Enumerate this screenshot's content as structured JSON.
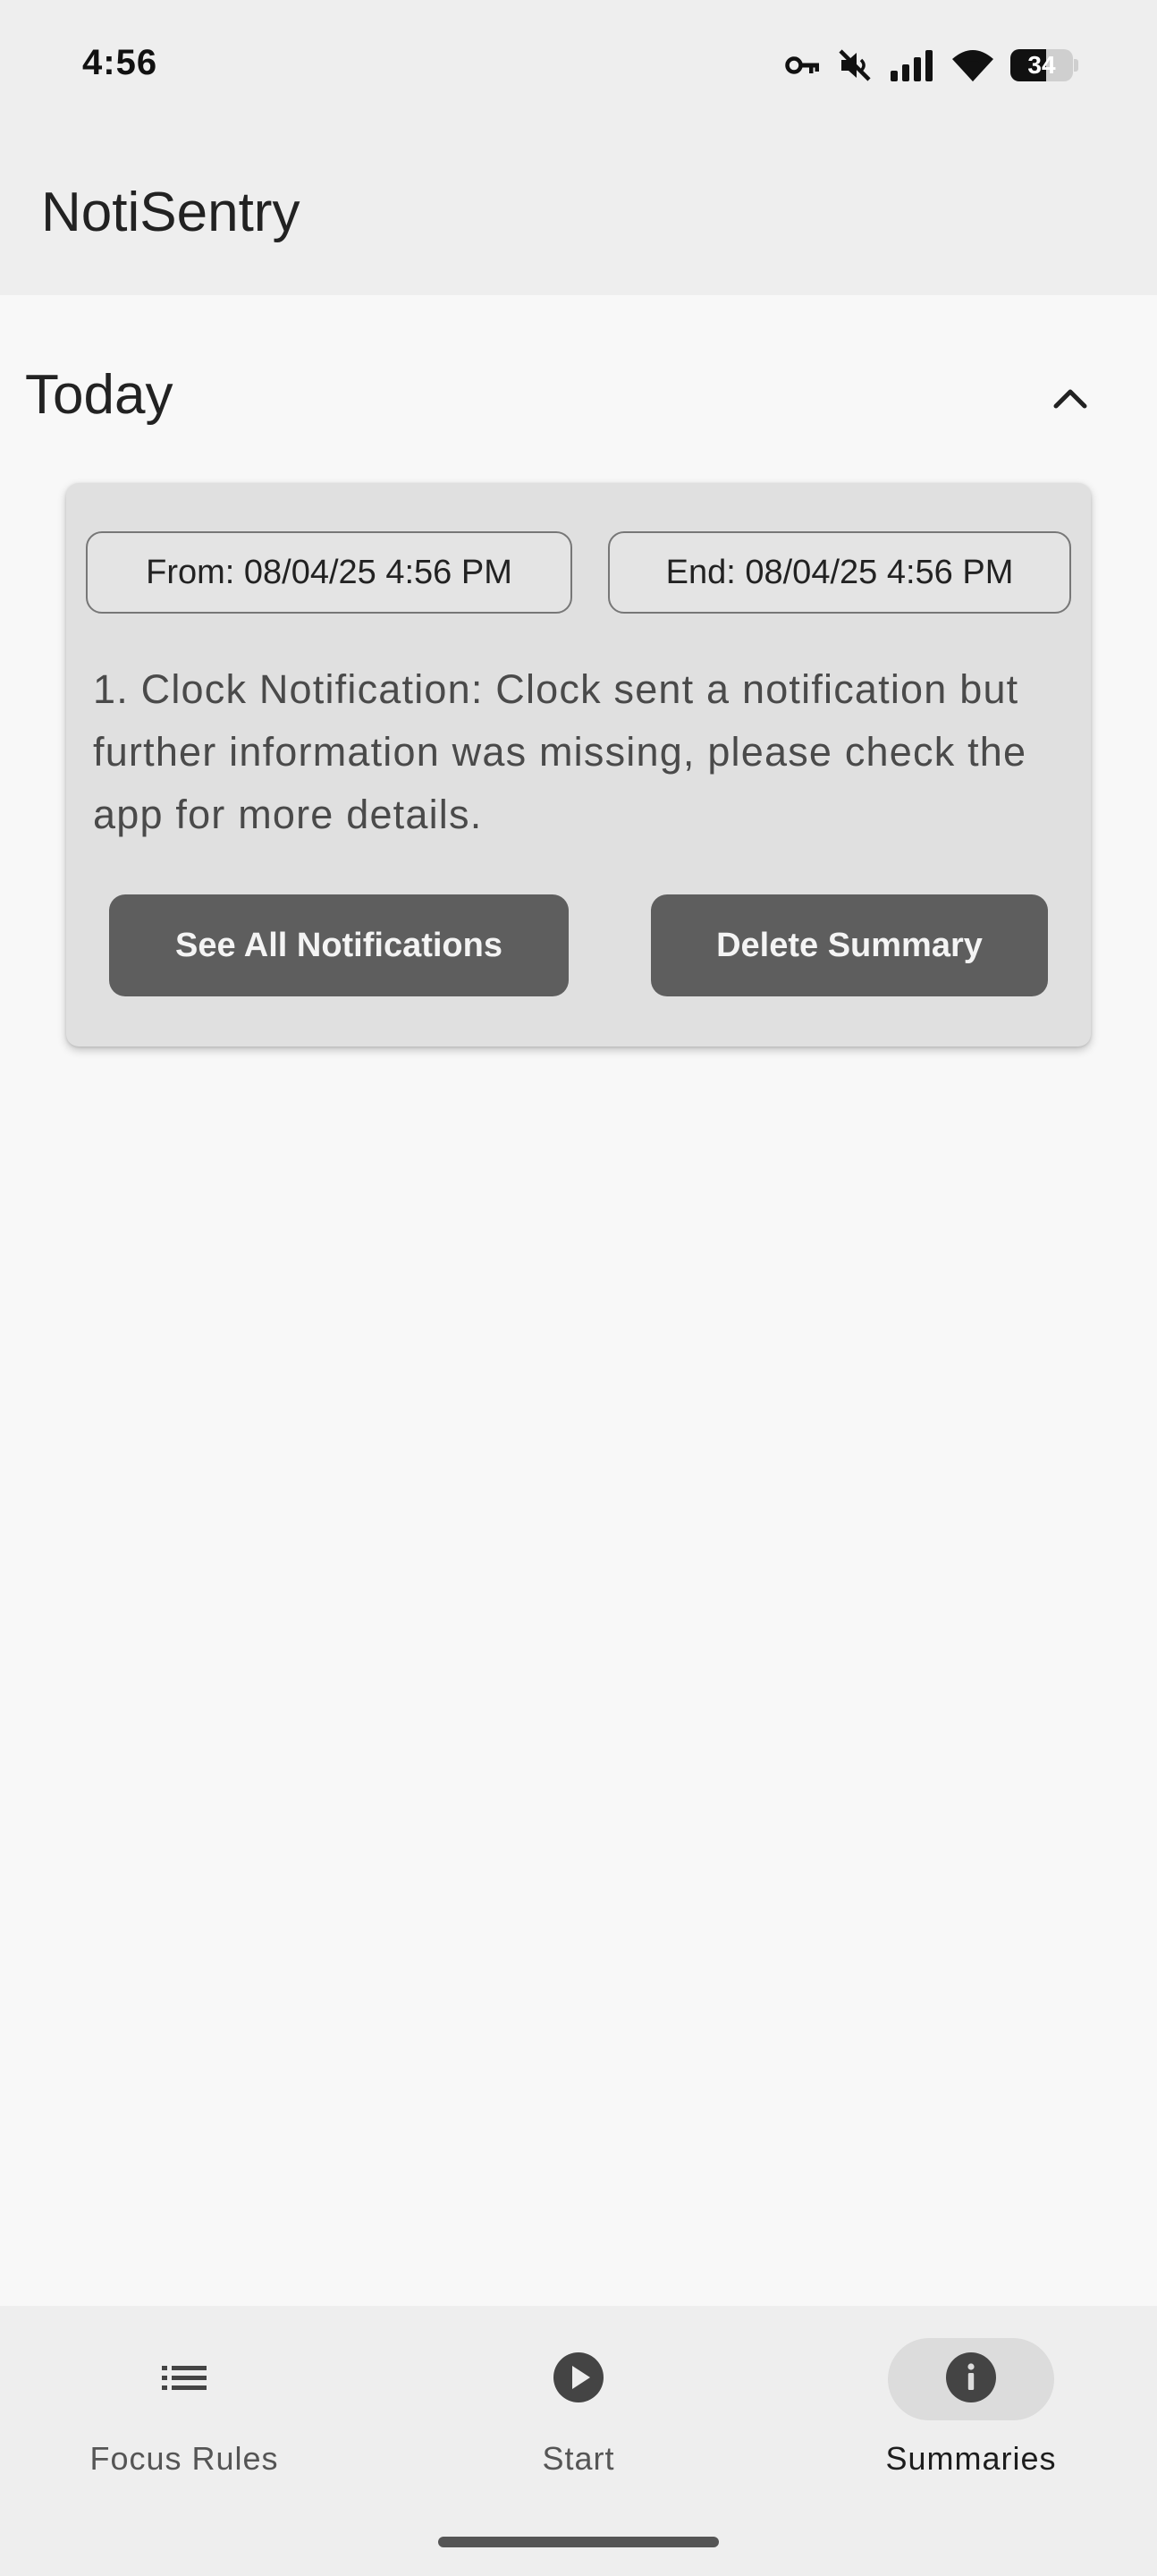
{
  "status_bar": {
    "time": "4:56",
    "battery_level": "34",
    "icons": [
      "vpn-key-icon",
      "mute-icon",
      "signal-icon",
      "wifi-icon",
      "battery-icon"
    ]
  },
  "app_bar": {
    "title": "NotiSentry"
  },
  "section": {
    "title": "Today",
    "collapse_icon": "chevron-up-icon"
  },
  "summary_card": {
    "from_label": "From: 08/04/25 4:56 PM",
    "end_label": "End: 08/04/25 4:56 PM",
    "text": "1. Clock Notification: Clock sent a notification but further information was missing, please check the app for more details.",
    "see_all_label": "See All Notifications",
    "delete_label": "Delete Summary"
  },
  "bottom_nav": {
    "items": [
      {
        "label": "Focus Rules",
        "icon": "list-icon",
        "active": false
      },
      {
        "label": "Start",
        "icon": "play-icon",
        "active": false
      },
      {
        "label": "Summaries",
        "icon": "info-icon",
        "active": true
      }
    ]
  },
  "colors": {
    "background": "#f8f8f8",
    "bar_background": "#eeeeee",
    "card_background": "#e0e0e0",
    "button_background": "#5e5e5e"
  }
}
